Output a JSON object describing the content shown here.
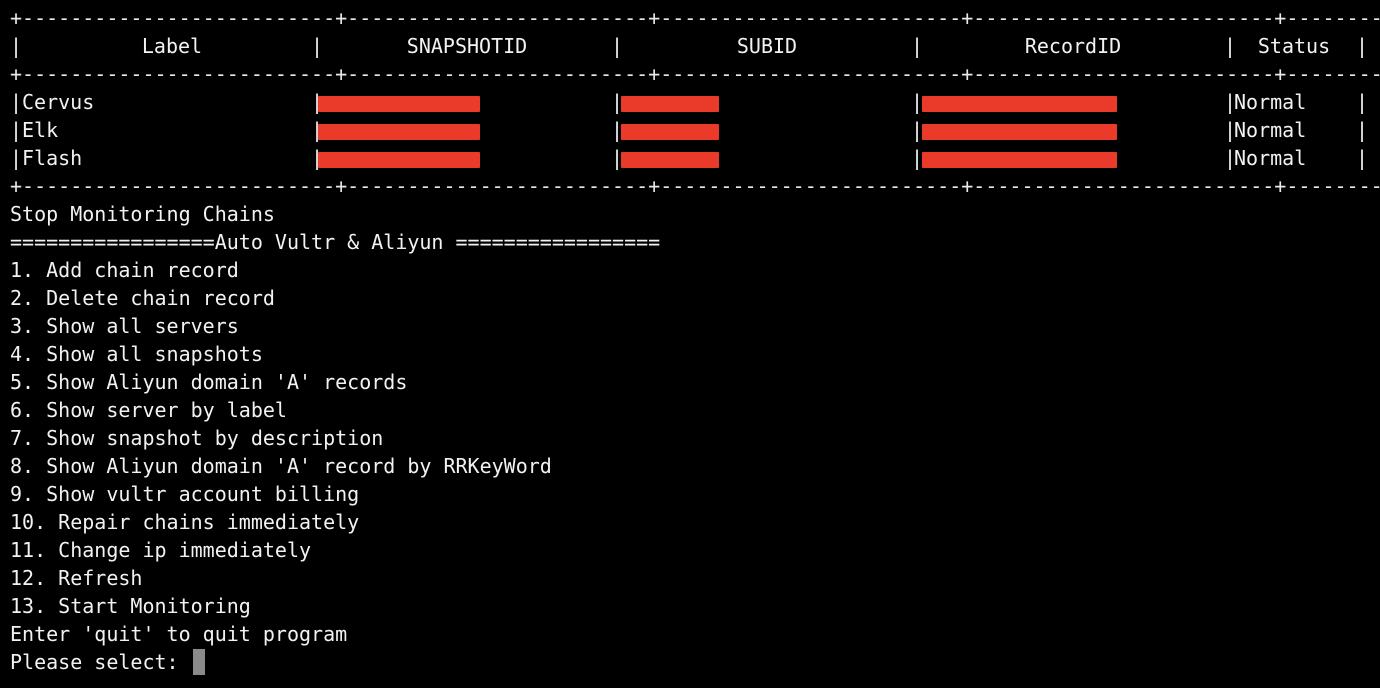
{
  "table": {
    "border_line": "+--------------------------+-------------------------+-------------------------+-------------------------+-----------+",
    "headers": [
      "Label",
      "SNAPSHOTID",
      "SUBID",
      "RecordID",
      "Status"
    ],
    "rows": [
      {
        "label": "Cervus",
        "status": "Normal"
      },
      {
        "label": "Elk",
        "status": "Normal"
      },
      {
        "label": "Flash",
        "status": "Normal"
      }
    ]
  },
  "output": {
    "stop_message": "Stop Monitoring Chains",
    "menu_title": "=================Auto Vultr & Aliyun =================",
    "menu_items": [
      "1. Add chain record",
      "2. Delete chain record",
      "3. Show all servers",
      "4. Show all snapshots",
      "5. Show Aliyun domain 'A' records",
      "6. Show server by label",
      "7. Show snapshot by description",
      "8. Show Aliyun domain 'A' record by RRKeyWord",
      "9. Show vultr account billing",
      "10. Repair chains immediately",
      "11. Change ip immediately",
      "12. Refresh",
      "13. Start Monitoring"
    ],
    "quit_hint": "Enter 'quit' to quit program",
    "prompt": "Please select: "
  },
  "colors": {
    "background": "#000000",
    "text": "#f2f2f2",
    "redaction": "#ea3b2a",
    "cursor": "#8a8a8a"
  }
}
